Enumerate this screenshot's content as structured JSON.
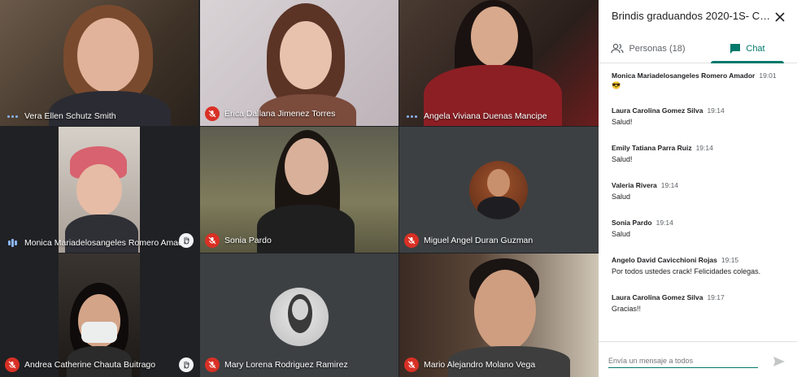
{
  "meeting": {
    "title": "Brindis graduandos 2020-1S- Co..."
  },
  "tabs": {
    "people_label": "Personas (18)",
    "chat_label": "Chat"
  },
  "participants": [
    {
      "name": "Vera Ellen Schutz Smith",
      "status": "speaking-dots"
    },
    {
      "name": "Erica Dallana Jimenez Torres",
      "status": "muted"
    },
    {
      "name": "Angela Viviana Duenas Mancipe",
      "status": "speaking-dots"
    },
    {
      "name": "Monica Mariadelosangeles Romero Amador",
      "status": "speaking-bars",
      "hand_raised": true
    },
    {
      "name": "Sonia Pardo",
      "status": "muted"
    },
    {
      "name": "Miguel Angel Duran Guzman",
      "status": "muted"
    },
    {
      "name": "Andrea Catherine Chauta Buitrago",
      "status": "muted",
      "hand_raised": true
    },
    {
      "name": "Mary Lorena Rodriguez Ramirez",
      "status": "muted"
    },
    {
      "name": "Mario Alejandro Molano Vega",
      "status": "muted"
    }
  ],
  "chat": {
    "messages": [
      {
        "sender": "Monica Mariadelosangeles Romero Amador",
        "time": "19:01",
        "text": "😎"
      },
      {
        "sender": "Laura Carolina Gomez Silva",
        "time": "19:14",
        "text": "Salud!"
      },
      {
        "sender": "Emily Tatiana Parra Ruiz",
        "time": "19:14",
        "text": "Salud!"
      },
      {
        "sender": "Valeria Rivera",
        "time": "19:14",
        "text": "Salud"
      },
      {
        "sender": "Sonia Pardo",
        "time": "19:14",
        "text": "Salud"
      },
      {
        "sender": "Angelo David Cavicchioni Rojas",
        "time": "19:15",
        "text": "Por todos ustedes crack! Felicidades colegas."
      },
      {
        "sender": "Laura Carolina Gomez Silva",
        "time": "19:17",
        "text": "Gracias!!"
      }
    ],
    "input_placeholder": "Envía un mensaje a todos"
  },
  "colors": {
    "accent": "#00796b",
    "muted_red": "#d93025",
    "speaking_blue": "#8ab4f8"
  },
  "icons": [
    "close-icon",
    "people-icon",
    "chat-icon",
    "mic-off-icon",
    "hand-raised-icon",
    "send-icon"
  ]
}
